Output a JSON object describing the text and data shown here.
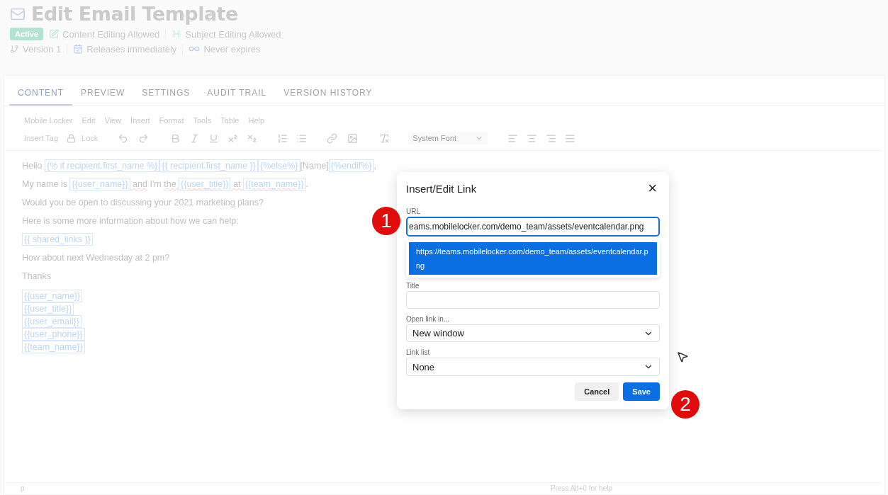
{
  "header": {
    "title": "Edit Email Template",
    "status": "Active",
    "flags": [
      {
        "kind": "edit",
        "text": "Content Editing Allowed"
      },
      {
        "kind": "heading",
        "text": "Subject Editing Allowed"
      }
    ],
    "meta": [
      {
        "kind": "version",
        "text": "Version 1"
      },
      {
        "kind": "calendar",
        "text": "Releases immediately"
      },
      {
        "kind": "infinity",
        "text": "Never expires"
      }
    ]
  },
  "tabs": [
    {
      "label": "CONTENT",
      "selected": true
    },
    {
      "label": "PREVIEW",
      "selected": false
    },
    {
      "label": "SETTINGS",
      "selected": false
    },
    {
      "label": "AUDIT TRAIL",
      "selected": false
    },
    {
      "label": "VERSION HISTORY",
      "selected": false
    }
  ],
  "editor": {
    "menu": [
      "Mobile Locker",
      "Edit",
      "View",
      "Insert",
      "Format",
      "Tools",
      "Table",
      "Help"
    ],
    "toolbar": {
      "insert_tag": "Insert Tag",
      "lock": "Lock",
      "font": "System Font"
    },
    "paragraphs": [
      [
        {
          "kind": "text",
          "text": "Hello "
        },
        {
          "kind": "tag",
          "text": "{% if recipient.first_name %}"
        },
        {
          "kind": "tag",
          "text": "{{ recipient.first_name }}"
        },
        {
          "kind": "tag",
          "text": "{%else%}"
        },
        {
          "kind": "text",
          "text": "[Name]"
        },
        {
          "kind": "tag",
          "text": "{%endif%}"
        },
        {
          "kind": "text",
          "text": ","
        }
      ],
      [
        {
          "kind": "text",
          "text": "My name is "
        },
        {
          "kind": "tag",
          "text": "{{user_name}}"
        },
        {
          "kind": "text",
          "text": " and",
          "misspelled": true
        },
        {
          "kind": "text",
          "text": " I'm "
        },
        {
          "kind": "text",
          "text": "the ",
          "misspelled": true
        },
        {
          "kind": "tag",
          "text": "{{user_title}}",
          "misspelled": true
        },
        {
          "kind": "text",
          "text": " at ",
          "misspelled": true
        },
        {
          "kind": "tag",
          "text": "{{team_name}}",
          "misspelled": true
        },
        {
          "kind": "text",
          "text": "."
        }
      ],
      [
        {
          "kind": "text",
          "text": "Would you be open to discussing your 2021 marketing plans?"
        }
      ],
      [
        {
          "kind": "text",
          "text": "Here is some more information about how we can help:"
        }
      ],
      [
        {
          "kind": "tag",
          "text": "{{ shared_links }}"
        }
      ],
      [
        {
          "kind": "text",
          "text": "How about next Wednesday at 2 pm?"
        }
      ],
      [
        {
          "kind": "text",
          "text": "Thanks"
        }
      ]
    ],
    "signature": [
      "{{user_name}}",
      "{{user_title}}",
      "{{user_email}}",
      "{{user_phone}}",
      "{{team_name}}"
    ],
    "status_bar": {
      "left": "p",
      "right": "Press Alt+0 for help"
    }
  },
  "dialog": {
    "title": "Insert/Edit Link",
    "close": "×",
    "url": {
      "label": "URL",
      "value": "eams.mobilelocker.com/demo_team/assets/eventcalendar.png",
      "focused": true
    },
    "suggestions": [
      {
        "text": "https://teams.mobilelocker.com/demo_team/assets/eventcalendar.png",
        "selected": true
      }
    ],
    "fields": [
      {
        "kind": "text",
        "label": "Title"
      },
      {
        "kind": "select",
        "label": "Open link in...",
        "value": "New window"
      },
      {
        "kind": "select",
        "label": "Link list",
        "value": "None"
      }
    ],
    "buttons": [
      {
        "label": "Cancel",
        "primary": false
      },
      {
        "label": "Save",
        "primary": true
      }
    ]
  },
  "step_markers": [
    "1",
    "2"
  ]
}
